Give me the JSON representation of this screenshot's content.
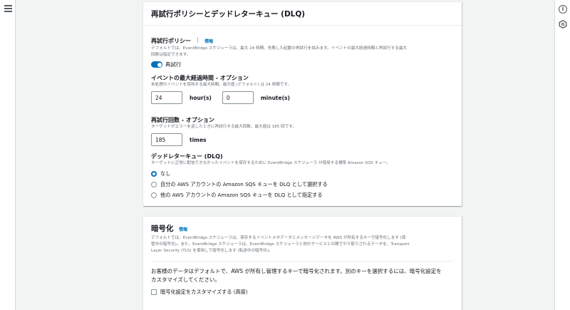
{
  "retry_panel": {
    "title": "再試行ポリシーとデッドレターキュー (DLQ)",
    "retry_policy": {
      "label": "再試行ポリシー",
      "info": "情報",
      "description_1": "デフォルトでは、EventBridge スケジューラは、最大 24 時間、失敗した起動の再試行を試みます。イベントの最大経過時間と再試行する最大",
      "description_2": "回数は指定できます。",
      "toggle_label": "再試行",
      "toggle_on": true
    },
    "max_age": {
      "label": "イベントの最大経過時間 - オプション",
      "description": "未処理のイベントを保持する最大時間。最大値 (デフォルト) は 24 時間です。",
      "hours_value": "24",
      "hours_unit": "hour(s)",
      "minutes_value": "0",
      "minutes_unit": "minute(s)"
    },
    "retry_attempts": {
      "label": "再試行回数 - オプション",
      "description": "ターゲットがエラーを返したときに再試行する最大回数。最大値は 185 回です。",
      "value": "185",
      "unit": "times"
    },
    "dlq": {
      "label": "デッドレターキュー (DLQ)",
      "description": "ターゲットに正常に配信できなかったイベントを保存するために EventBridge スケジューラ が使用する標準 Amazon SQS キュー。",
      "options": [
        {
          "label": "なし",
          "checked": true
        },
        {
          "label": "自分の AWS アカウントの Amazon SQS キューを DLQ として選択する",
          "checked": false
        },
        {
          "label": "他の AWS アカウントの Amazon SQS キューを DLQ として指定する",
          "checked": false
        }
      ]
    }
  },
  "encryption_panel": {
    "title": "暗号化",
    "info": "情報",
    "description_1": "デフォルトでは、EventBridge スケジューラは、保存するイベントメタデータとメッセージデータを AWS が所有するキーで暗号化します (保",
    "description_2": "管中の暗号化)。また、EventBridge スケジューラは、EventBridge スケジューラと他のサービスとの間でやり取りされるデータを、Transport",
    "description_3": "Layer Security (TLS) を使用して暗号化します (転送中の暗号化)。",
    "note_1": "お客様のデータはデフォルトで、AWS が所有し管理するキーで暗号化されます。別のキーを選択するには、暗号化設定を",
    "note_2": "カスタマイズしてください。",
    "checkbox_label": "暗号化設定をカスタマイズする (高度)",
    "checkbox_checked": false
  },
  "icons": {
    "menu": "hamburger-icon",
    "info": "info-icon",
    "tool": "hexagon-icon"
  },
  "colors": {
    "accent": "#0073bb",
    "background": "#f2f3f3"
  }
}
